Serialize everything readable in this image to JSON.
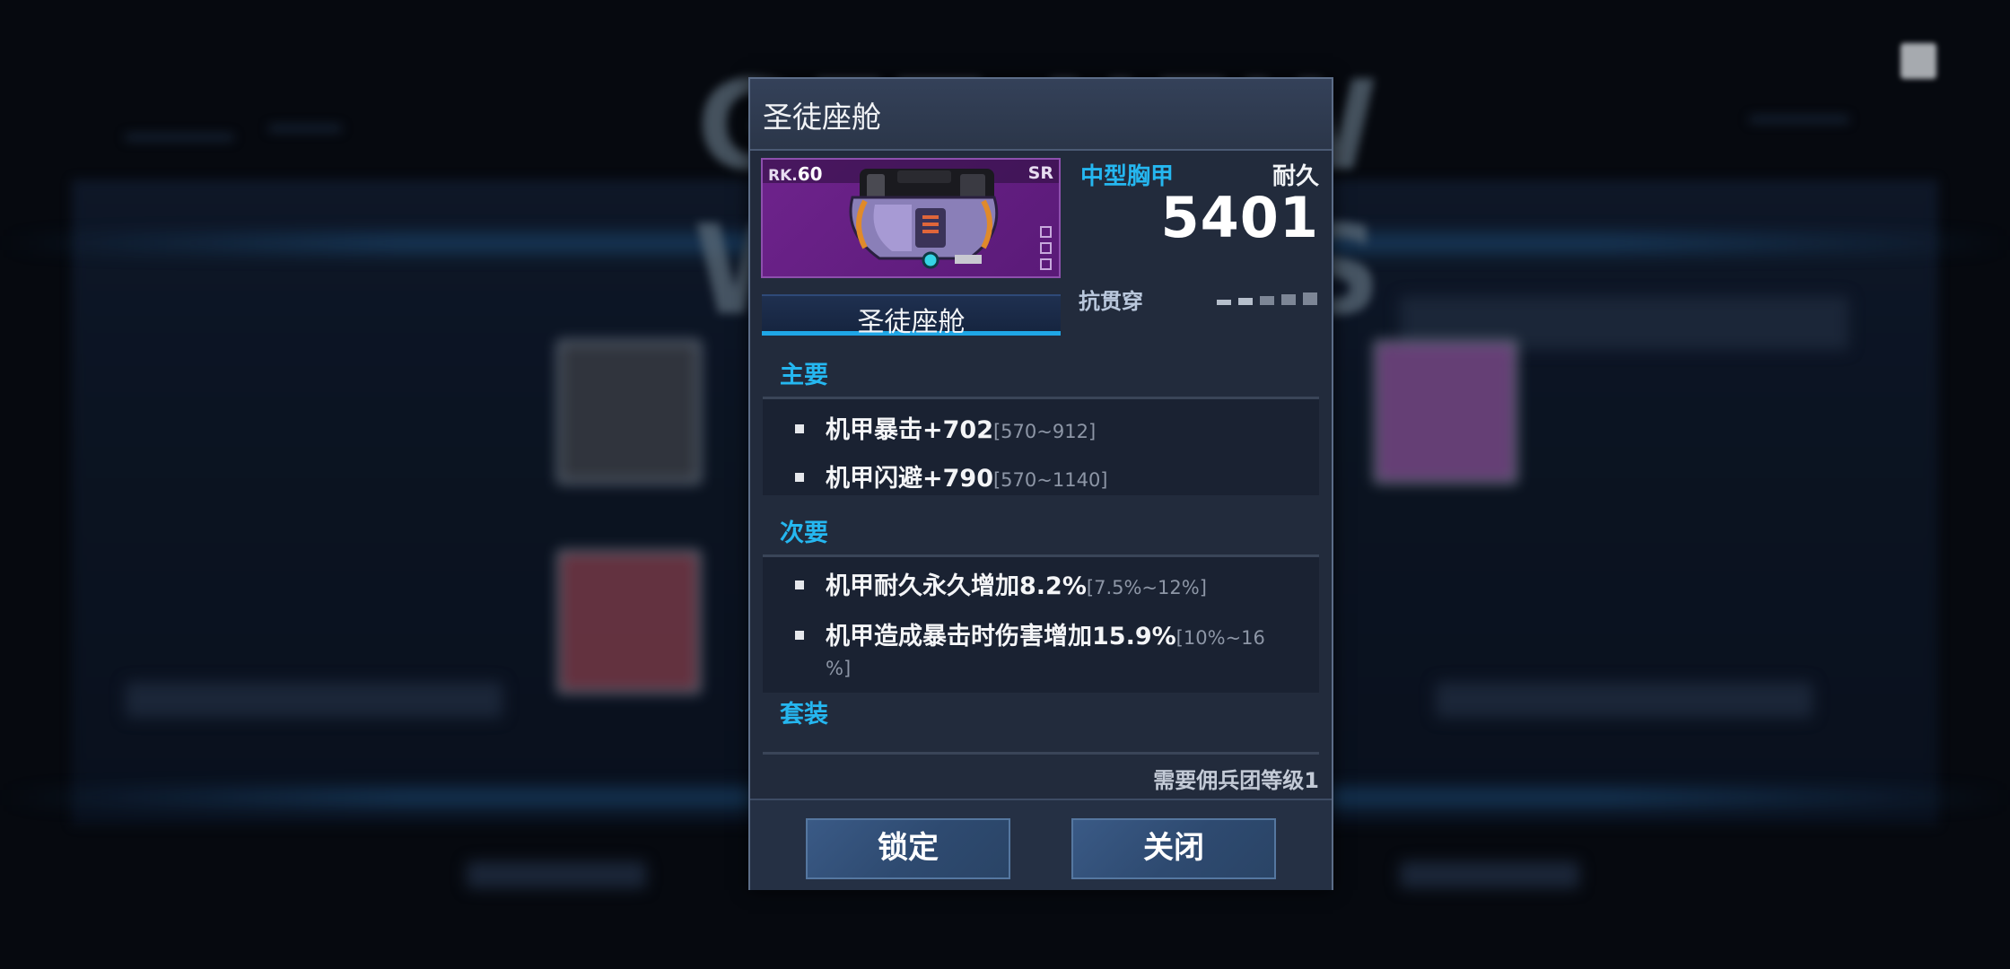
{
  "background": {
    "banner_text": "GET NEW WIDGETS"
  },
  "dialog": {
    "title": "圣徒座舱",
    "item": {
      "rank_prefix": "RK.",
      "rank_value": "60",
      "rarity": "SR",
      "name": "圣徒座舱",
      "image_color": "#6e238c"
    },
    "type_label": "中型胸甲",
    "durability_label": "耐久",
    "durability_value": "5401",
    "penetration_label": "抗贯穿",
    "penetration_level": 2,
    "penetration_max": 5,
    "primary": {
      "title": "主要",
      "stats": [
        {
          "text": "机甲暴击+702",
          "range": "[570~912]"
        },
        {
          "text": "机甲闪避+790",
          "range": "[570~1140]"
        }
      ]
    },
    "secondary": {
      "title": "次要",
      "stats": [
        {
          "text": "机甲耐久永久增加8.2%",
          "range": "[7.5%~12%]"
        },
        {
          "text": "机甲造成暴击时伤害增加15.9%",
          "range_line1": "[10%~16",
          "range_line2": "%]"
        }
      ]
    },
    "set": {
      "title": "套装"
    },
    "requirement": "需要佣兵团等级1",
    "buttons": {
      "lock": "锁定",
      "close": "关闭"
    },
    "accent_color": "#25b7f0"
  }
}
